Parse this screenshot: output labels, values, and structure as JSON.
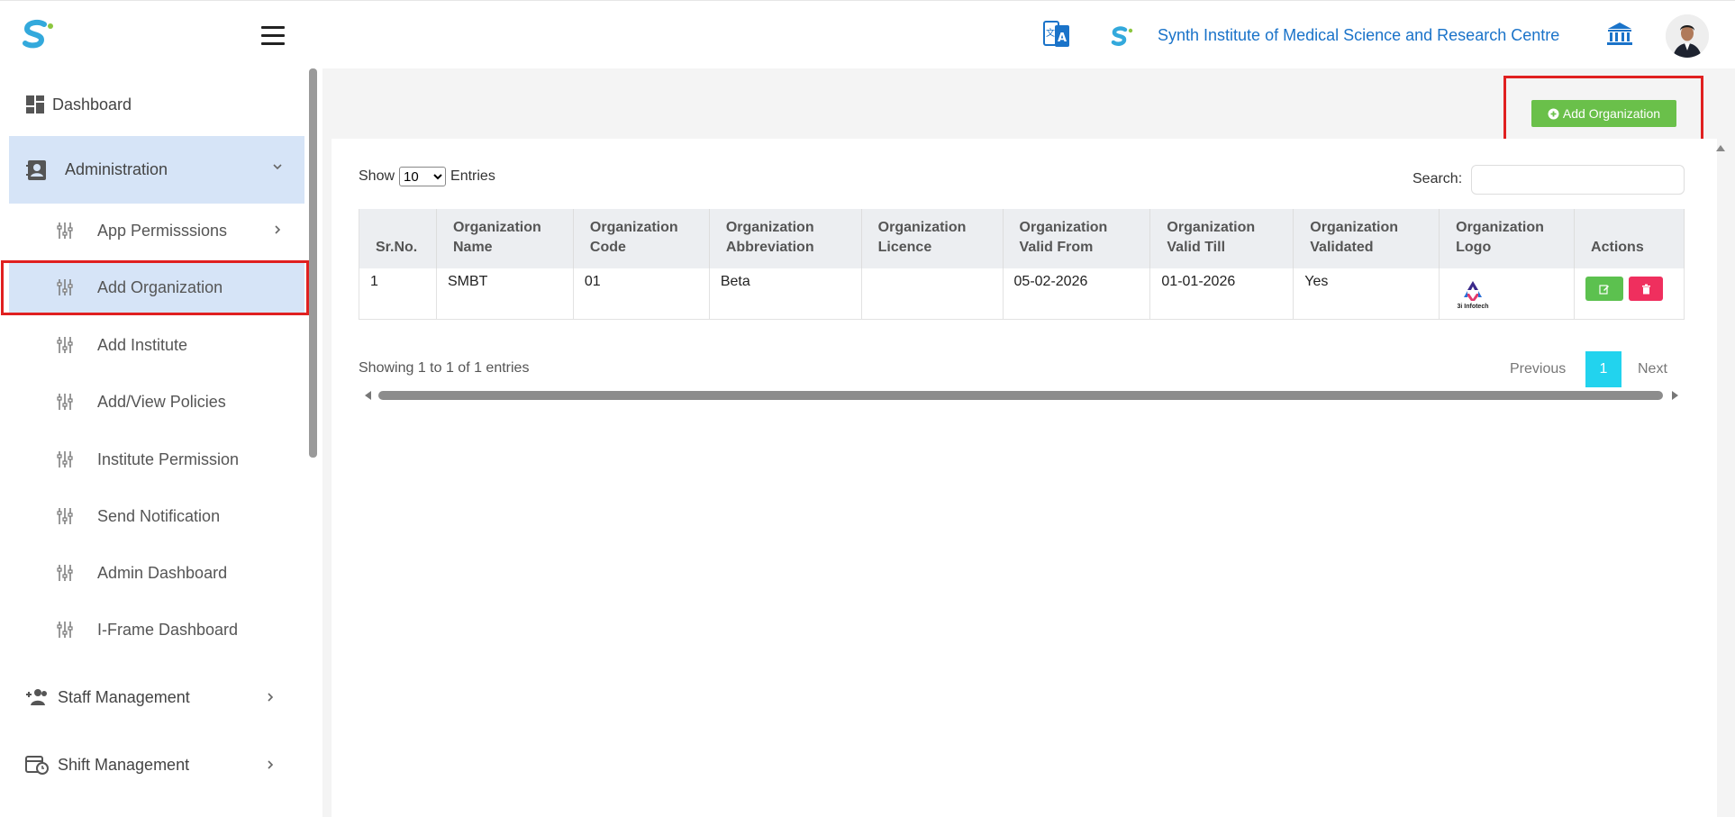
{
  "header": {
    "institute_name": "Synth Institute of Medical Science and Research Centre",
    "icons": [
      "app-logo-icon",
      "hamburger-icon",
      "translate-icon",
      "institute-logo-icon",
      "bank-icon",
      "avatar"
    ]
  },
  "sidebar": {
    "dashboard": "Dashboard",
    "administration": "Administration",
    "admin_items": [
      {
        "label": "App Permisssions",
        "has_chevron": true
      },
      {
        "label": "Add Organization",
        "active": true
      },
      {
        "label": "Add Institute"
      },
      {
        "label": "Add/View Policies"
      },
      {
        "label": "Institute Permission"
      },
      {
        "label": "Send Notification"
      },
      {
        "label": "Admin Dashboard"
      },
      {
        "label": "I-Frame Dashboard"
      }
    ],
    "staff_management": "Staff Management",
    "shift_management": "Shift Management"
  },
  "main": {
    "add_button": "Add Organization",
    "show_label": "Show",
    "entries_value": "10",
    "entries_label": "Entries",
    "search_label": "Search:",
    "columns": [
      [
        "Sr.No.",
        ""
      ],
      [
        "Organization",
        "Name"
      ],
      [
        "Organization",
        "Code"
      ],
      [
        "Organization",
        "Abbreviation"
      ],
      [
        "Organization",
        "Licence"
      ],
      [
        "Organization",
        "Valid From"
      ],
      [
        "Organization",
        "Valid Till"
      ],
      [
        "Organization",
        "Validated"
      ],
      [
        "Organization",
        "Logo"
      ],
      [
        "Actions",
        ""
      ]
    ],
    "rows": [
      {
        "sr": "1",
        "name": "SMBT",
        "code": "01",
        "abbreviation": "Beta",
        "licence": "",
        "valid_from": "05-02-2026",
        "valid_till": "01-01-2026",
        "validated": "Yes",
        "logo_text": "3i Infotech"
      }
    ],
    "showing": "Showing 1 to 1 of 1 entries",
    "previous": "Previous",
    "page": "1",
    "next": "Next"
  },
  "colors": {
    "accent_blue": "#1a73c9",
    "active_bg": "#d6e4f7",
    "green": "#6ac04a",
    "red": "#ef2f5e",
    "page_cyan": "#22d3ee",
    "highlight_red": "#e02020"
  }
}
